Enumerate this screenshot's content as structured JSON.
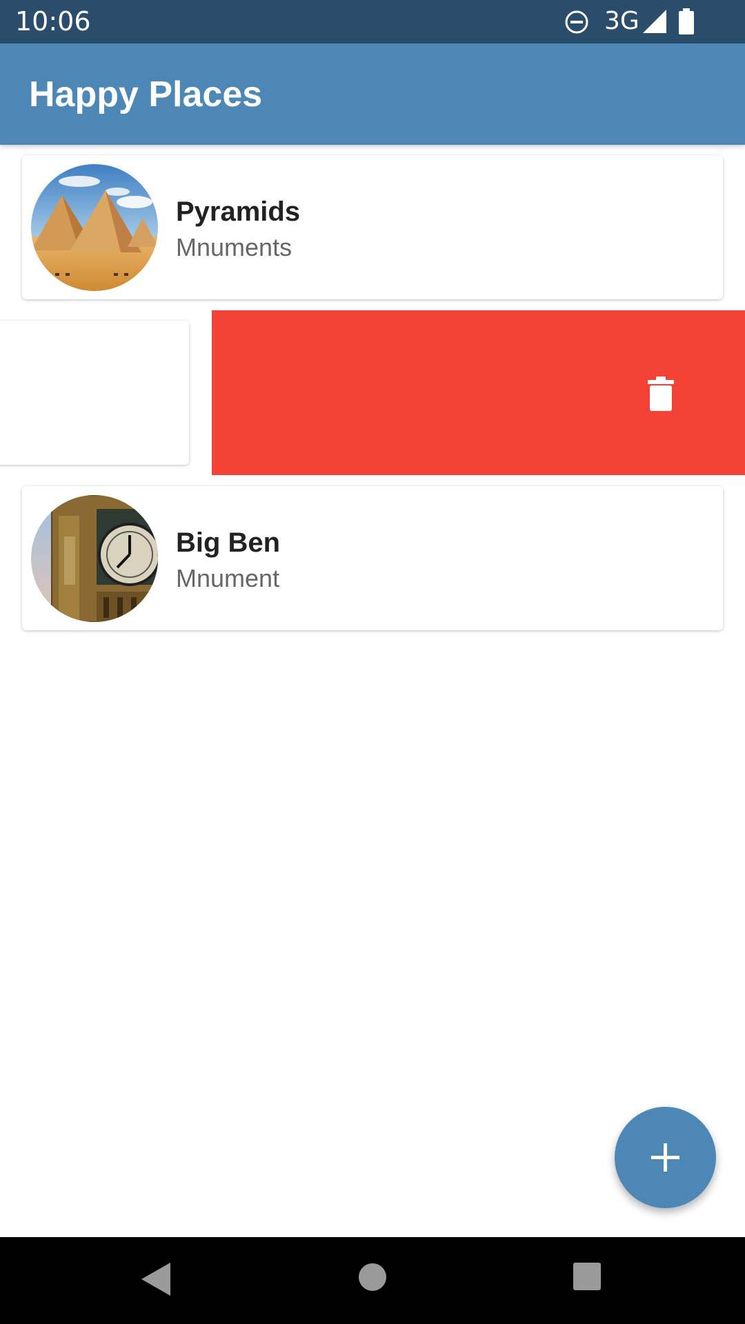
{
  "status_bar": {
    "time": "10:06",
    "network": "3G",
    "icons": [
      "do-not-disturb-icon",
      "signal-icon",
      "battery-icon"
    ]
  },
  "app_bar": {
    "title": "Happy Places",
    "color": "#4c87b6"
  },
  "places": [
    {
      "name": "Pyramids",
      "category": "Mnuments",
      "image": "pyramids-image"
    },
    {
      "name": "Big Ben",
      "category": "Mnument",
      "image": "big-ben-image"
    }
  ],
  "swipe_action": {
    "icon": "trash-icon",
    "color": "#f44336"
  },
  "fab": {
    "icon": "plus-icon",
    "color": "#4c87b6"
  },
  "nav_bar": {
    "icons": [
      "back-icon",
      "home-icon",
      "recents-icon"
    ]
  }
}
